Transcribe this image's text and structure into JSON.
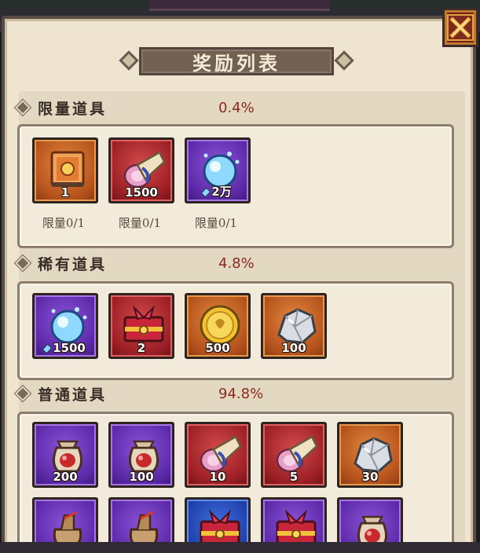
{
  "title": "奖励列表",
  "sections": [
    {
      "title": "限量道具",
      "rate": "0.4%",
      "items": [
        {
          "icon": "spellbook-icon",
          "rarity": "orange",
          "count": "1",
          "gem": false,
          "limit": "限量0/1"
        },
        {
          "icon": "scroll-icon",
          "rarity": "red",
          "count": "1500",
          "gem": false,
          "limit": "限量0/1"
        },
        {
          "icon": "spirit-crystal-icon",
          "rarity": "purple",
          "count": "2万",
          "gem": true,
          "limit": "限量0/1"
        }
      ]
    },
    {
      "title": "稀有道具",
      "rate": "4.8%",
      "items": [
        {
          "icon": "spirit-crystal-icon",
          "rarity": "purple",
          "count": "1500",
          "gem": true
        },
        {
          "icon": "treasure-chest-icon",
          "rarity": "red",
          "count": "2",
          "gem": false
        },
        {
          "icon": "gold-coin-icon",
          "rarity": "orange",
          "count": "500",
          "gem": false
        },
        {
          "icon": "silver-ore-icon",
          "rarity": "orange",
          "count": "100",
          "gem": false
        }
      ]
    },
    {
      "title": "普通道具",
      "rate": "94.8%",
      "items": [
        {
          "icon": "pouch-icon",
          "rarity": "purple",
          "count": "200",
          "gem": false
        },
        {
          "icon": "pouch-icon",
          "rarity": "purple",
          "count": "100",
          "gem": false
        },
        {
          "icon": "scroll-icon",
          "rarity": "red",
          "count": "10",
          "gem": false
        },
        {
          "icon": "scroll-icon",
          "rarity": "red",
          "count": "5",
          "gem": false
        },
        {
          "icon": "silver-ore-icon",
          "rarity": "orange",
          "count": "30",
          "gem": false
        },
        {
          "icon": "bag-icon",
          "rarity": "purple",
          "count": "",
          "gem": false
        },
        {
          "icon": "bag-icon",
          "rarity": "purple",
          "count": "",
          "gem": false
        },
        {
          "icon": "treasure-chest-icon",
          "rarity": "blue",
          "count": "",
          "gem": false
        },
        {
          "icon": "treasure-chest-icon",
          "rarity": "purple",
          "count": "",
          "gem": false
        },
        {
          "icon": "pouch-icon",
          "rarity": "purple",
          "count": "",
          "gem": false
        }
      ]
    }
  ]
}
